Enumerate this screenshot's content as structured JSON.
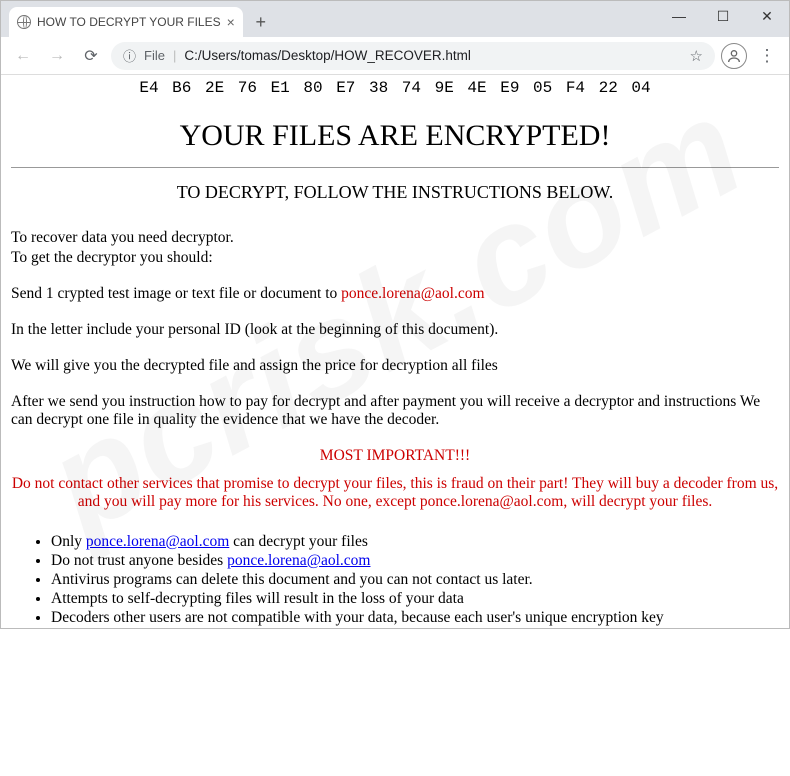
{
  "tab": {
    "title": "HOW TO DECRYPT YOUR FILES"
  },
  "address": {
    "file_label": "File",
    "path": "C:/Users/tomas/Desktop/HOW_RECOVER.html"
  },
  "content": {
    "hex": "E4 B6 2E 76 E1 80 E7 38 74 9E 4E E9 05 F4 22 04",
    "h1": "YOUR FILES ARE ENCRYPTED!",
    "sub": "TO DECRYPT, FOLLOW THE INSTRUCTIONS BELOW.",
    "p1": "To recover data you need decryptor.",
    "p2": "To get the decryptor you should:",
    "p3a": "Send 1 crypted test image or text file or document to ",
    "email": "ponce.lorena@aol.com",
    "p4": "In the letter include your personal ID (look at the beginning of this document).",
    "p5": "We will give you the decrypted file and assign the price for decryption all files",
    "p6": "After we send you instruction how to pay for decrypt and after payment you will receive a decryptor and instructions We can decrypt one file in quality the evidence that we have the decoder.",
    "imp_title": "MOST IMPORTANT!!!",
    "imp_body_a": "Do not contact other services that promise to decrypt your files, this is fraud on their part! They will buy a decoder from us, and you will pay more for his services. No one, except ",
    "imp_body_b": ", will decrypt your files.",
    "bullets": {
      "b1a": "Only ",
      "b1b": " can decrypt your files",
      "b2a": "Do not trust anyone besides ",
      "b3": "Antivirus programs can delete this document and you can not contact us later.",
      "b4": "Attempts to self-decrypting files will result in the loss of your data",
      "b5": "Decoders other users are not compatible with your data, because each user's unique encryption key"
    }
  },
  "watermark": "pcrisk.com"
}
